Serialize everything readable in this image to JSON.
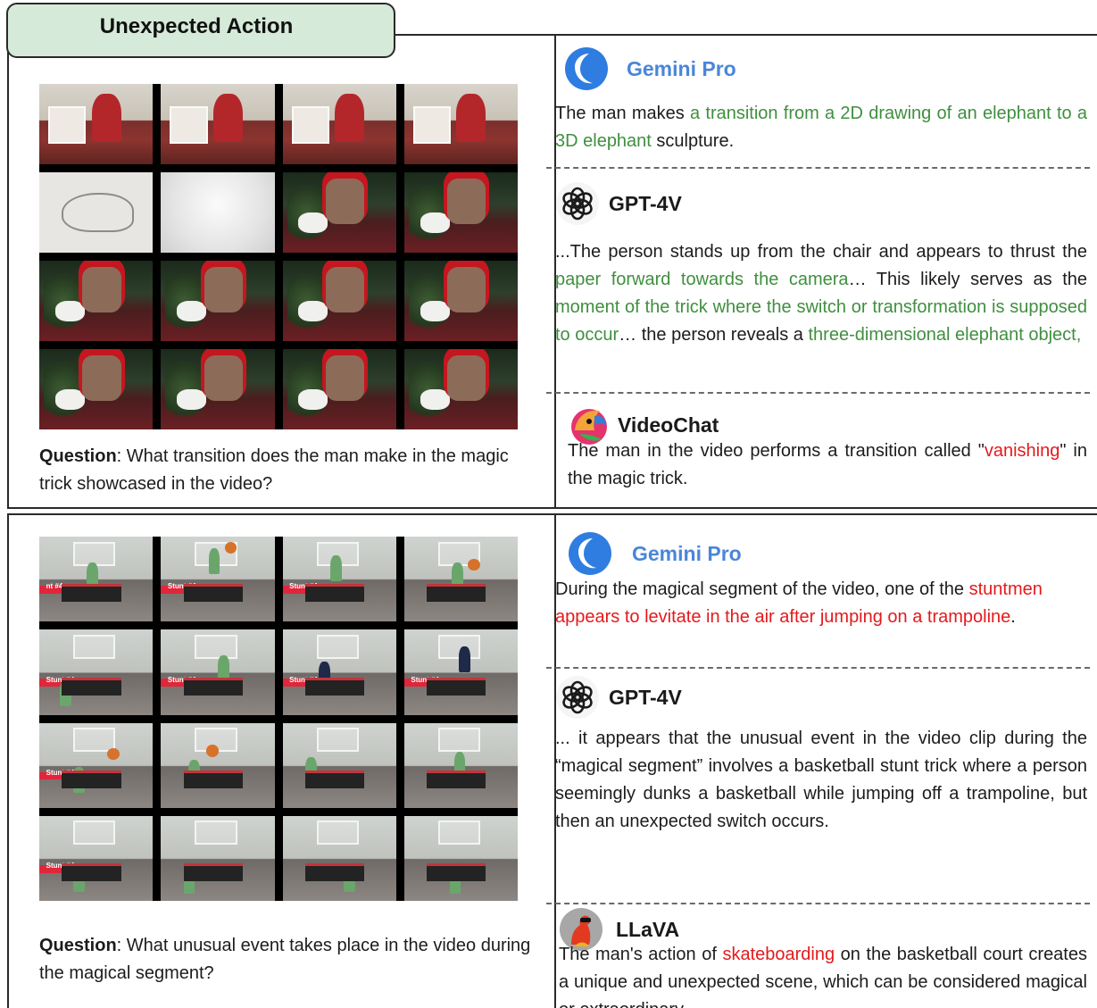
{
  "tab_title": "Unexpected Action",
  "panel1": {
    "question_label": "Question",
    "question_text": ": What transition does the man make in the magic trick showcased in the video?",
    "responses": {
      "gemini": {
        "model": "Gemini Pro",
        "t1": "The man makes ",
        "h1": "a transition from a 2D drawing of an elephant to a 3D elephant",
        "t2": " sculpture."
      },
      "gpt4v": {
        "model": "GPT-4V",
        "t1": "...The person stands up from the chair and appears to thrust the ",
        "h1": "paper forward towards the camera",
        "t2": "… This likely serves as the ",
        "h2": "moment of the trick where the switch or transformation is supposed to occur",
        "t3": "… the person reveals a ",
        "h3": "three-dimensional elephant object,"
      },
      "videochat": {
        "model": "VideoChat",
        "t1": "The man in the video performs a transition called \"",
        "h1": "vanishing",
        "t2": "\" in the magic trick."
      }
    }
  },
  "panel2": {
    "question_label": "Question",
    "question_text": ": What unusual event takes place in the video during the magical segment?",
    "frame_labels": [
      "nt #4",
      "Stunt #4",
      "Stunt #4",
      "Stunt #4",
      "Stunt #4",
      "Stunt #4",
      "Stunt #4",
      "Stunt #4",
      "Stunt #4"
    ],
    "responses": {
      "gemini": {
        "model": "Gemini Pro",
        "t1": "During the magical segment of the video, one of the ",
        "h1": "stuntmen appears to levitate in the air after jumping on a trampoline",
        "t2": "."
      },
      "gpt4v": {
        "model": "GPT-4V",
        "t1": "... it appears that the unusual event in the video clip during the “magical segment” involves a basketball stunt trick where a person seemingly dunks a basketball while jumping off a trampoline, but then an unexpected switch occurs."
      },
      "llava": {
        "model": "LLaVA",
        "t1": "The man's action of ",
        "h1": "skateboarding",
        "t2": " on the basketball court creates a unique and unexpected scene, which can be considered magical or extraordinary."
      }
    }
  },
  "colors": {
    "correct": "#3f8f3f",
    "wrong": "#e41a1c",
    "tab_bg": "#d5ead8",
    "gemini_name": "#4a86d9"
  },
  "icons": [
    "gemini-logo-icon",
    "openai-logo-icon",
    "videochat-parrot-icon",
    "llava-lava-icon"
  ]
}
